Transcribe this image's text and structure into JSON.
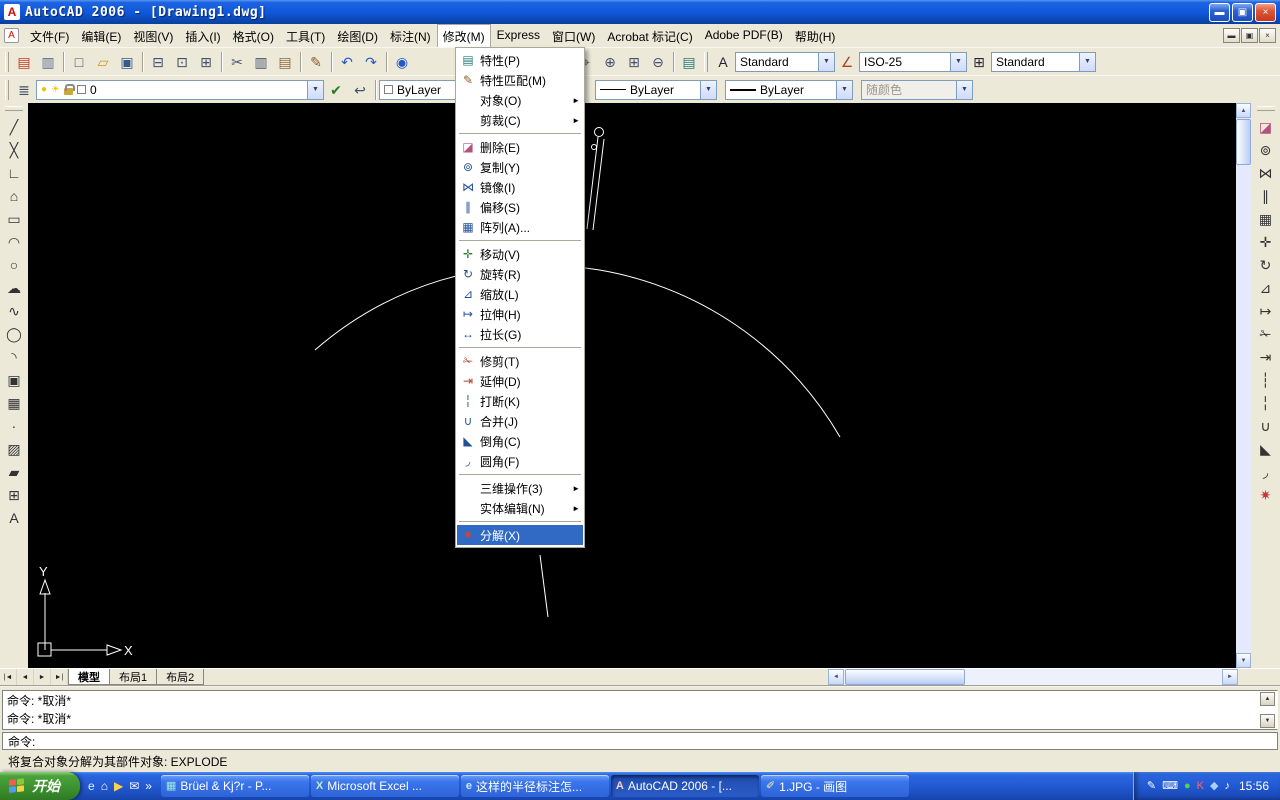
{
  "window": {
    "title": "AutoCAD 2006 - [Drawing1.dwg]"
  },
  "menubar": {
    "items": [
      "文件(F)",
      "编辑(E)",
      "视图(V)",
      "插入(I)",
      "格式(O)",
      "工具(T)",
      "绘图(D)",
      "标注(N)",
      "修改(M)",
      "Express",
      "窗口(W)",
      "Acrobat 标记(C)",
      "Adobe PDF(B)",
      "帮助(H)"
    ]
  },
  "modify_menu": {
    "items": [
      {
        "label": "特性(P)"
      },
      {
        "label": "特性匹配(M)"
      },
      {
        "label": "对象(O)"
      },
      {
        "label": "剪裁(C)"
      },
      {
        "type": "sep"
      },
      {
        "label": "删除(E)"
      },
      {
        "label": "复制(Y)"
      },
      {
        "label": "镜像(I)"
      },
      {
        "label": "偏移(S)"
      },
      {
        "label": "阵列(A)..."
      },
      {
        "type": "sep"
      },
      {
        "label": "移动(V)"
      },
      {
        "label": "旋转(R)"
      },
      {
        "label": "缩放(L)"
      },
      {
        "label": "拉伸(H)"
      },
      {
        "label": "拉长(G)"
      },
      {
        "type": "sep"
      },
      {
        "label": "修剪(T)"
      },
      {
        "label": "延伸(D)"
      },
      {
        "label": "打断(K)"
      },
      {
        "label": "合并(J)"
      },
      {
        "label": "倒角(C)"
      },
      {
        "label": "圆角(F)"
      },
      {
        "type": "sep"
      },
      {
        "label": "三维操作(3)"
      },
      {
        "label": "实体编辑(N)"
      },
      {
        "type": "sep"
      },
      {
        "label": "分解(X)"
      }
    ]
  },
  "toolbar1": {
    "text_style": "Standard",
    "dim_style": "ISO-25",
    "table_style": "Standard"
  },
  "toolbar2": {
    "layer_name": "0",
    "color": "ByLayer",
    "linetype": "ByLayer",
    "lineweight": "ByLayer",
    "plot_style": "随颜色"
  },
  "canvas": {
    "ucs": {
      "x": "X",
      "y": "Y"
    }
  },
  "tabs": {
    "nav": [
      "|◄",
      "◄",
      "►",
      "►|"
    ],
    "items": [
      "模型",
      "布局1",
      "布局2"
    ]
  },
  "command": {
    "history": [
      "命令: *取消*",
      "命令: *取消*"
    ],
    "prompt": "命令:"
  },
  "statusbar": {
    "help": "将复合对象分解为其部件对象:  EXPLODE"
  },
  "taskbar": {
    "start": "开始",
    "buttons": [
      {
        "label": "Brüel & Kj?r - P..."
      },
      {
        "label": "Microsoft Excel ..."
      },
      {
        "label": "这样的半径标注怎..."
      },
      {
        "label": "AutoCAD 2006 - [..."
      },
      {
        "label": "1.JPG - 画图"
      }
    ],
    "tray": {
      "time": "15:56"
    }
  },
  "icons": {
    "app-a": {
      "g": "A",
      "c": "#cc1100"
    },
    "win-min": {
      "g": "▬",
      "c": "#ffffff"
    },
    "win-restore": {
      "g": "▣",
      "c": "#ffffff"
    },
    "win-close": {
      "g": "×",
      "c": "#ffffff"
    },
    "mdi-min": {
      "g": "▬",
      "c": "#333333"
    },
    "mdi-restore": {
      "g": "▣",
      "c": "#333333"
    },
    "mdi-close": {
      "g": "×",
      "c": "#333333"
    },
    "qnew": {
      "g": "▤",
      "c": "#c23b22"
    },
    "sheetset": {
      "g": "▥",
      "c": "#5a6b8c"
    },
    "new": {
      "g": "□",
      "c": "#44506b"
    },
    "open": {
      "g": "▱",
      "c": "#c9971c"
    },
    "save": {
      "g": "▣",
      "c": "#3a5a8c"
    },
    "plot": {
      "g": "⊟",
      "c": "#44506b"
    },
    "preview": {
      "g": "⊡",
      "c": "#44506b"
    },
    "publish": {
      "g": "⊞",
      "c": "#44506b"
    },
    "cut": {
      "g": "✂",
      "c": "#44506b"
    },
    "copy": {
      "g": "▥",
      "c": "#44506b"
    },
    "paste": {
      "g": "▤",
      "c": "#8c6a3a"
    },
    "match": {
      "g": "✎",
      "c": "#8c5a2a"
    },
    "undo": {
      "g": "↶",
      "c": "#2458c8"
    },
    "redo": {
      "g": "↷",
      "c": "#2458c8"
    },
    "hyperlink": {
      "g": "◉",
      "c": "#2458c8"
    },
    "pan": {
      "g": "⌖",
      "c": "#44506b"
    },
    "zoom-rt": {
      "g": "⊕",
      "c": "#44506b"
    },
    "zoom-win": {
      "g": "⊞",
      "c": "#44506b"
    },
    "zoom-prev": {
      "g": "⊖",
      "c": "#44506b"
    },
    "palette": {
      "g": "▤",
      "c": "#2a7a7a"
    },
    "text-style": {
      "g": "A",
      "c": "#222233"
    },
    "dim-style": {
      "g": "∠",
      "c": "#aa4422"
    },
    "table-style": {
      "g": "⊞",
      "c": "#222233"
    },
    "layers": {
      "g": "≣",
      "c": "#44506b"
    },
    "make-current": {
      "g": "✔",
      "c": "#2a7a2a"
    },
    "layer-prev": {
      "g": "↩",
      "c": "#44506b"
    },
    "bulb": {
      "g": "●",
      "c": "#e8c500"
    },
    "sun": {
      "g": "☀",
      "c": "#e8c500"
    },
    "cdown": {
      "g": "▼"
    },
    "up": {
      "g": "▲"
    },
    "down": {
      "g": "▼"
    },
    "left-ar": {
      "g": "◄"
    },
    "right-ar": {
      "g": "►"
    },
    "line": {
      "g": "╱",
      "c": "#333333"
    },
    "xline": {
      "g": "╳",
      "c": "#333333"
    },
    "pline": {
      "g": "∟",
      "c": "#333333"
    },
    "polygon": {
      "g": "⌂",
      "c": "#333333"
    },
    "rect": {
      "g": "▭",
      "c": "#333333"
    },
    "arc": {
      "g": "◠",
      "c": "#333333"
    },
    "circle": {
      "g": "○",
      "c": "#333333"
    },
    "revcloud": {
      "g": "☁",
      "c": "#333333"
    },
    "spline": {
      "g": "∿",
      "c": "#333333"
    },
    "ellipse": {
      "g": "◯",
      "c": "#333333"
    },
    "earc": {
      "g": "◝",
      "c": "#333333"
    },
    "iblock": {
      "g": "▣",
      "c": "#333333"
    },
    "mblock": {
      "g": "▦",
      "c": "#333333"
    },
    "point": {
      "g": "∙",
      "c": "#333333"
    },
    "hatch": {
      "g": "▨",
      "c": "#333333"
    },
    "region": {
      "g": "▰",
      "c": "#333333"
    },
    "table": {
      "g": "⊞",
      "c": "#333333"
    },
    "mtext": {
      "g": "A",
      "c": "#333333"
    },
    "erase": {
      "g": "◪",
      "c": "#b4517d"
    },
    "copyobj": {
      "g": "⊚",
      "c": "#333333"
    },
    "mirror": {
      "g": "⋈",
      "c": "#333333"
    },
    "offset": {
      "g": "∥",
      "c": "#333333"
    },
    "array": {
      "g": "▦",
      "c": "#333333"
    },
    "move": {
      "g": "✛",
      "c": "#333333"
    },
    "rotate": {
      "g": "↻",
      "c": "#333333"
    },
    "scale": {
      "g": "⊿",
      "c": "#333333"
    },
    "stretch": {
      "g": "↦",
      "c": "#333333"
    },
    "trim": {
      "g": "✁",
      "c": "#333333"
    },
    "extend": {
      "g": "⇥",
      "c": "#333333"
    },
    "breakpt": {
      "g": "┆",
      "c": "#333333"
    },
    "break": {
      "g": "╎",
      "c": "#333333"
    },
    "join": {
      "g": "∪",
      "c": "#333333"
    },
    "chamfer": {
      "g": "◣",
      "c": "#333333"
    },
    "fillet": {
      "g": "◞",
      "c": "#333333"
    },
    "explode": {
      "g": "✷",
      "c": "#cc3333"
    },
    "mi-properties": {
      "g": "▤",
      "c": "#2a7a7a"
    },
    "mi-match": {
      "g": "✎",
      "c": "#8c5a2a"
    },
    "mi-erase": {
      "g": "◪",
      "c": "#b4517d"
    },
    "mi-copy": {
      "g": "⊚",
      "c": "#24509b"
    },
    "mi-mirror": {
      "g": "⋈",
      "c": "#24509b"
    },
    "mi-offset": {
      "g": "∥",
      "c": "#24509b"
    },
    "mi-array": {
      "g": "▦",
      "c": "#24509b"
    },
    "mi-move": {
      "g": "✛",
      "c": "#2a7a2a"
    },
    "mi-rotate": {
      "g": "↻",
      "c": "#24509b"
    },
    "mi-scale": {
      "g": "⊿",
      "c": "#24509b"
    },
    "mi-stretch": {
      "g": "↦",
      "c": "#24509b"
    },
    "mi-lengthen": {
      "g": "↔",
      "c": "#24509b"
    },
    "mi-trim": {
      "g": "✁",
      "c": "#aa4422"
    },
    "mi-extend": {
      "g": "⇥",
      "c": "#aa4422"
    },
    "mi-break": {
      "g": "╎",
      "c": "#24509b"
    },
    "mi-join": {
      "g": "∪",
      "c": "#24509b"
    },
    "mi-chamfer": {
      "g": "◣",
      "c": "#24509b"
    },
    "mi-fillet": {
      "g": "◞",
      "c": "#24509b"
    },
    "mi-explode": {
      "g": "✷",
      "c": "#d4452a"
    },
    "submenu-arrow": {
      "g": "►"
    },
    "tb-bk": {
      "g": "▦",
      "c": "#9fe8d8"
    },
    "tb-excel": {
      "g": "X",
      "c": "#b9f0c9"
    },
    "tb-ie": {
      "g": "e",
      "c": "#cfe7ff"
    },
    "tb-acad": {
      "g": "A",
      "c": "#ffd0c0"
    },
    "tb-paint": {
      "g": "✐",
      "c": "#ffe9a8"
    },
    "ql-ie": {
      "g": "e",
      "c": "#dff0ff"
    },
    "ql-desktop": {
      "g": "⌂",
      "c": "#ffffff"
    },
    "ql-media": {
      "g": "▶",
      "c": "#ffd24a"
    },
    "ql-mail": {
      "g": "✉",
      "c": "#ffffff"
    },
    "chevron": {
      "g": "»",
      "c": "#ffffff"
    },
    "tray-pen": {
      "g": "✎",
      "c": "#ffffff"
    },
    "tray-kbd": {
      "g": "⌨",
      "c": "#ffffff"
    },
    "tray-green": {
      "g": "●",
      "c": "#52d452"
    },
    "tray-k": {
      "g": "K",
      "c": "#ff6666"
    },
    "tray-blue": {
      "g": "◆",
      "c": "#a8d0ff"
    },
    "tray-note": {
      "g": "♪",
      "c": "#ffffff"
    }
  }
}
